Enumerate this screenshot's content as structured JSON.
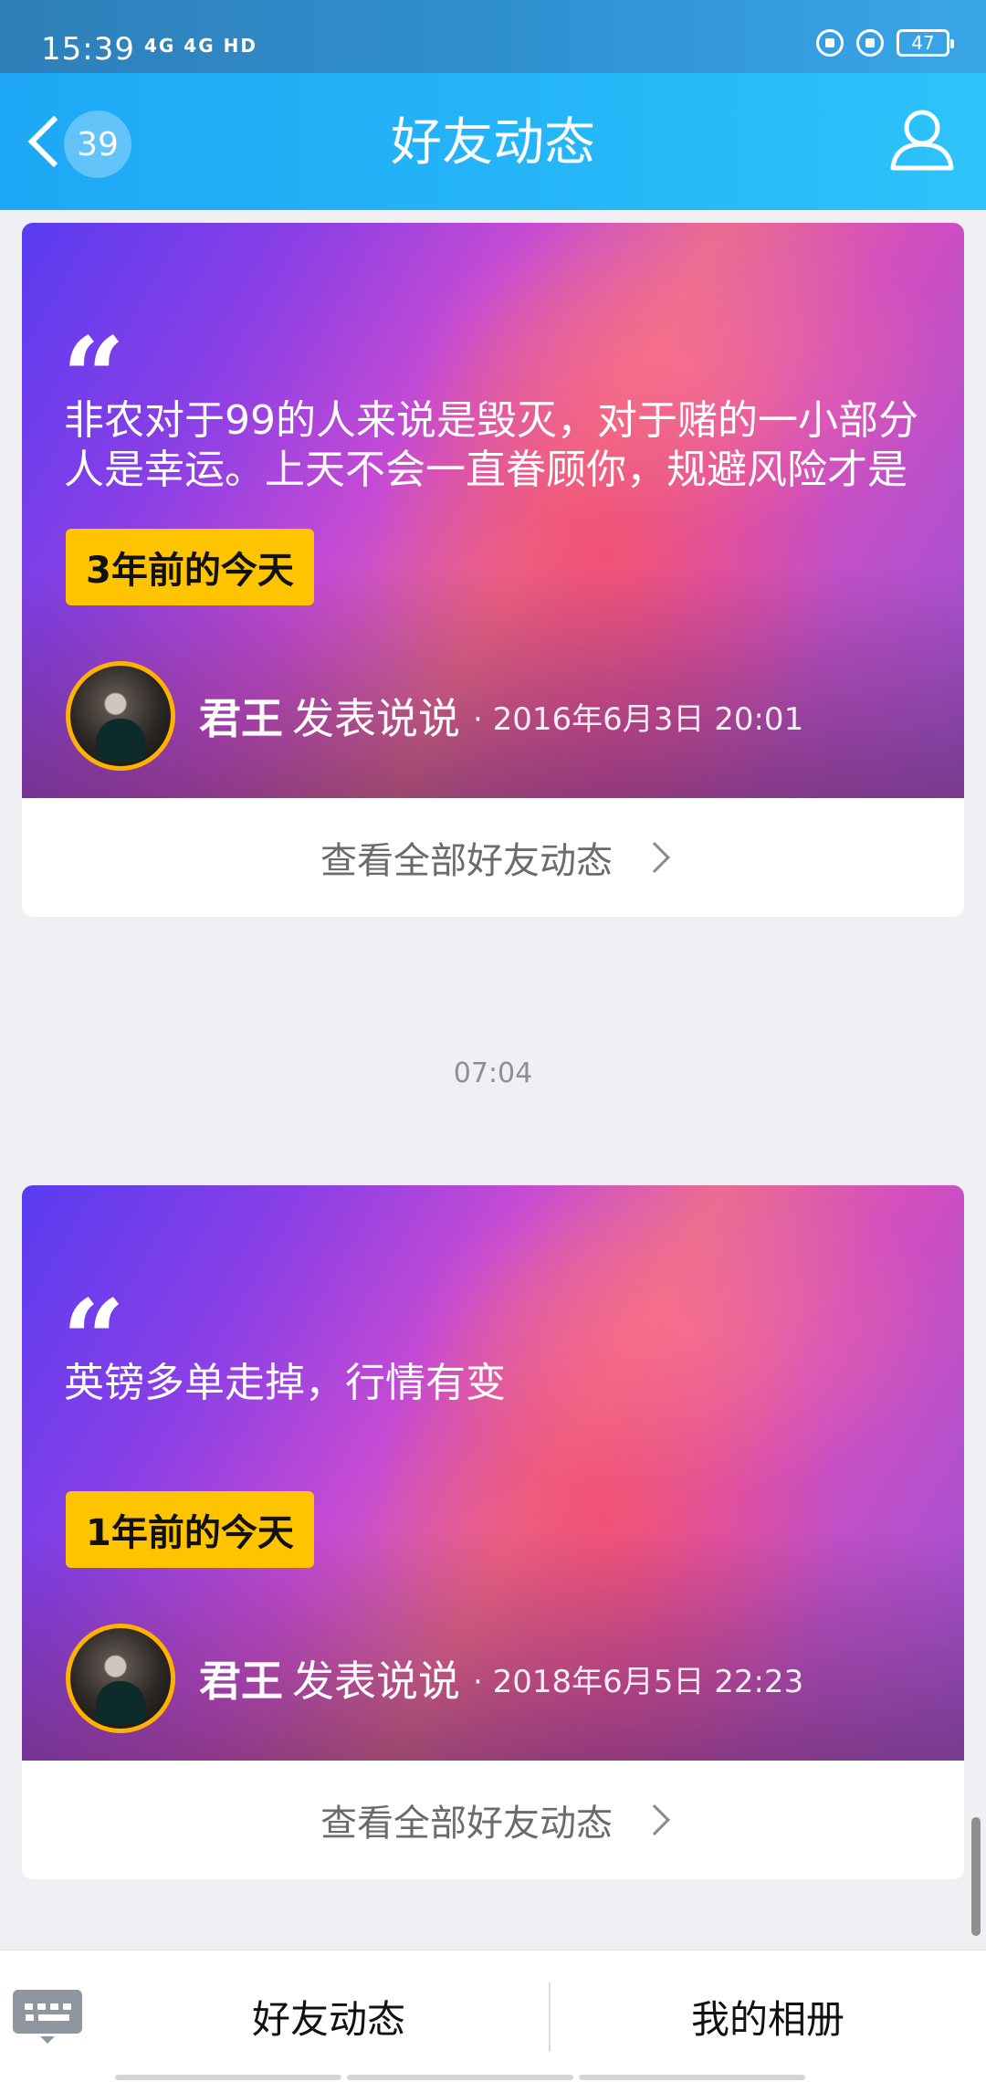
{
  "status_bar": {
    "time": "15:39",
    "network": "4G 4G HD",
    "battery": "47"
  },
  "header": {
    "back_count": "39",
    "title": "好友动态"
  },
  "feed": [
    {
      "quote_mark": "“",
      "text": "非农对于99的人来说是毁灭，对于赌的一小部分人是幸运。上天不会一直眷顾你，规避风险才是",
      "badge": "3年前的今天",
      "author": "君王",
      "action": "发表说说",
      "timestamp": "· 2016年6月3日 20:01",
      "view_all": "查看全部好友动态"
    },
    {
      "quote_mark": "“",
      "text": "英镑多单走掉，行情有变",
      "badge": "1年前的今天",
      "author": "君王",
      "action": "发表说说",
      "timestamp": "· 2018年6月5日 22:23",
      "view_all": "查看全部好友动态"
    }
  ],
  "time_separator": "07:04",
  "bottom_bar": {
    "tab_friends": "好友动态",
    "tab_album": "我的相册"
  },
  "colors": {
    "header": "#24b4f7",
    "badge": "#ffc400",
    "avatar_ring": "#ffb300",
    "background": "#efeff4"
  }
}
